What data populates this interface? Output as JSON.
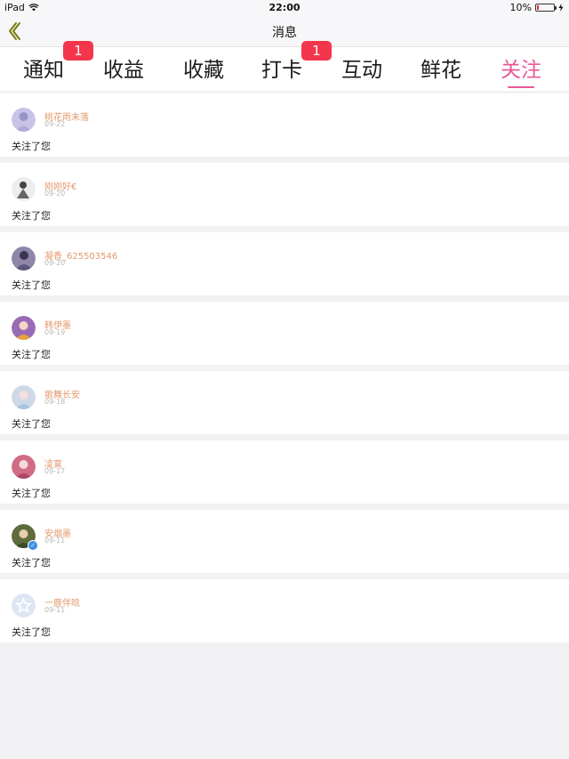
{
  "status_bar": {
    "device": "iPad",
    "time": "22:00",
    "battery_percent": "10%",
    "battery_level": 0.1,
    "battery_color": "#e0312f"
  },
  "nav": {
    "title": "消息",
    "back_icon": "chevron-left-icon",
    "back_icon_color": "#7a7a10"
  },
  "tabs": [
    {
      "label": "通知",
      "badge": "1",
      "active": false
    },
    {
      "label": "收益",
      "active": false
    },
    {
      "label": "收藏",
      "active": false
    },
    {
      "label": "打卡",
      "badge": "1",
      "active": false
    },
    {
      "label": "互动",
      "active": false
    },
    {
      "label": "鲜花",
      "active": false
    },
    {
      "label": "关注",
      "active": true
    }
  ],
  "colors": {
    "accent": "#e8589a",
    "badge": "#f4364c",
    "username": "#e49a6f"
  },
  "follows": [
    {
      "username": "桃花雨未落",
      "date": "09-22",
      "message": "关注了您"
    },
    {
      "username": "刚刚好€",
      "date": "09-20",
      "message": "关注了您"
    },
    {
      "username": "凝香_625503546",
      "date": "09-20",
      "message": "关注了您"
    },
    {
      "username": "韩伊墨",
      "date": "09-19",
      "message": "关注了您"
    },
    {
      "username": "歌舞长安",
      "date": "09-18",
      "message": "关注了您"
    },
    {
      "username": "凌寞",
      "date": "09-17",
      "message": "关注了您"
    },
    {
      "username": "安烟墨",
      "date": "09-11",
      "message": "关注了您",
      "verified": true
    },
    {
      "username": "一鹿伴晗",
      "date": "09-11",
      "message": "关注了您"
    }
  ]
}
